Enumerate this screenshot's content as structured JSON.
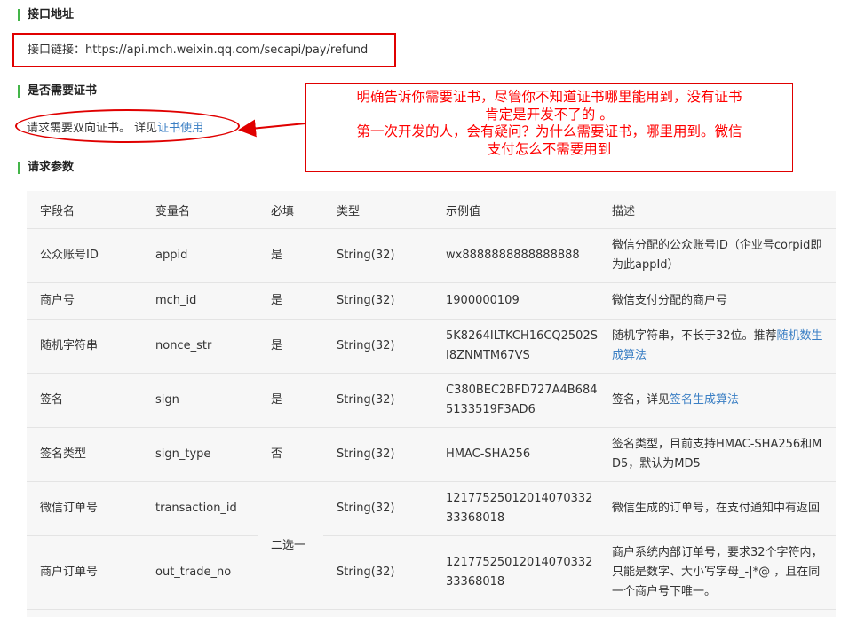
{
  "sections": {
    "endpoint_title": "接口地址",
    "cert_title": "是否需要证书",
    "params_title": "请求参数"
  },
  "endpoint": {
    "label": "接口链接：",
    "url": "https://api.mch.weixin.qq.com/secapi/pay/refund"
  },
  "cert": {
    "text": "请求需要双向证书。 详见",
    "link": "证书使用"
  },
  "annotation": {
    "line1": "明确告诉你需要证书，尽管你不知道证书哪里能用到，没有证书",
    "line2": "肯定是开发不了的  。",
    "line3": "第一次开发的人，会有疑问？为什么需要证书，哪里用到。微信",
    "line4": "支付怎么不需要用到"
  },
  "table": {
    "headers": [
      "字段名",
      "变量名",
      "必填",
      "类型",
      "示例值",
      "描述"
    ],
    "merged_required": "二选一",
    "rows": [
      {
        "field": "公众账号ID",
        "var": "appid",
        "req": "是",
        "type": "String(32)",
        "example": "wx8888888888888888",
        "desc": "微信分配的公众账号ID（企业号corpid即为此appId）",
        "link": ""
      },
      {
        "field": "商户号",
        "var": "mch_id",
        "req": "是",
        "type": "String(32)",
        "example": "1900000109",
        "desc": "微信支付分配的商户号",
        "link": ""
      },
      {
        "field": "随机字符串",
        "var": "nonce_str",
        "req": "是",
        "type": "String(32)",
        "example": "5K8264ILTKCH16CQ2502SI8ZNMTM67VS",
        "desc": "随机字符串，不长于32位。推荐",
        "link": "随机数生成算法"
      },
      {
        "field": "签名",
        "var": "sign",
        "req": "是",
        "type": "String(32)",
        "example": "C380BEC2BFD727A4B6845133519F3AD6",
        "desc": "签名，详见",
        "link": "签名生成算法"
      },
      {
        "field": "签名类型",
        "var": "sign_type",
        "req": "否",
        "type": "String(32)",
        "example": "HMAC-SHA256",
        "desc": "签名类型，目前支持HMAC-SHA256和MD5，默认为MD5",
        "link": ""
      },
      {
        "field": "微信订单号",
        "var": "transaction_id",
        "req": "",
        "type": "String(32)",
        "example": "1217752501201407033233368018",
        "desc": "微信生成的订单号，在支付通知中有返回",
        "link": ""
      },
      {
        "field": "商户订单号",
        "var": "out_trade_no",
        "req": "",
        "type": "String(32)",
        "example": "1217752501201407033233368018",
        "desc": "商户系统内部订单号，要求32个字符内，只能是数字、大小写字母_-|*@ ，且在同一个商户号下唯一。",
        "link": ""
      }
    ]
  },
  "colors": {
    "accent_green": "#44b549",
    "annotation_red": "#e00000",
    "link_blue": "#3b7fc4"
  }
}
